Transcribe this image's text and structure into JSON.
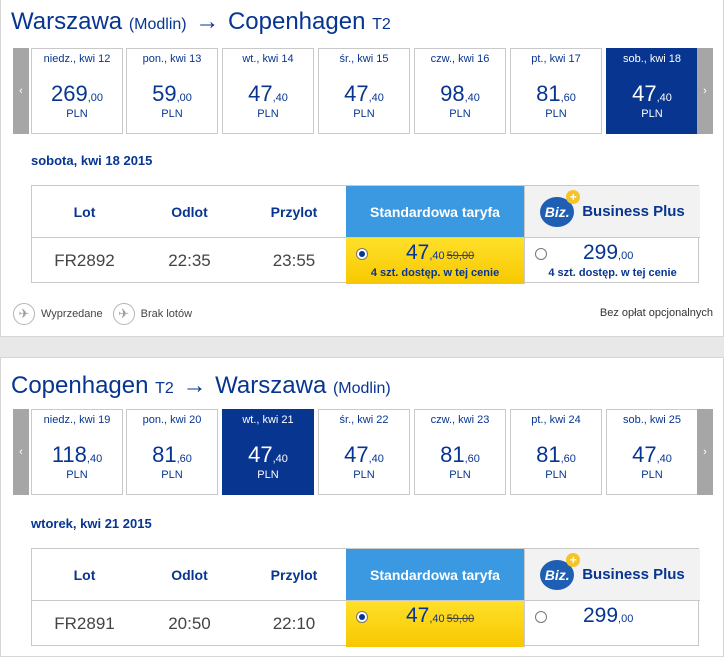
{
  "outbound": {
    "route": {
      "from": "Warszawa",
      "from_sub": "(Modlin)",
      "arrow": "→",
      "to": "Copenhagen",
      "to_sub": "T2"
    },
    "nav": {
      "prev": "‹",
      "next": "›"
    },
    "days": [
      {
        "label": "niedz., kwi 12",
        "int": "269",
        "dec": ",00",
        "cur": "PLN"
      },
      {
        "label": "pon., kwi 13",
        "int": "59",
        "dec": ",00",
        "cur": "PLN"
      },
      {
        "label": "wt., kwi 14",
        "int": "47",
        "dec": ",40",
        "cur": "PLN"
      },
      {
        "label": "śr., kwi 15",
        "int": "47",
        "dec": ",40",
        "cur": "PLN"
      },
      {
        "label": "czw., kwi 16",
        "int": "98",
        "dec": ",40",
        "cur": "PLN"
      },
      {
        "label": "pt., kwi 17",
        "int": "81",
        "dec": ",60",
        "cur": "PLN"
      },
      {
        "label": "sob., kwi 18",
        "int": "47",
        "dec": ",40",
        "cur": "PLN",
        "selected": true
      }
    ],
    "date": "sobota, kwi 18 2015",
    "headers": {
      "flight": "Lot",
      "dep": "Odlot",
      "arr": "Przylot",
      "standard": "Standardowa taryfa",
      "biz_logo": "Biz.",
      "biz_plus_mark": "+",
      "business": "Business Plus"
    },
    "row": {
      "flight": "FR2892",
      "dep": "22:35",
      "arr": "23:55",
      "std_int": "47",
      "std_dec": ",40",
      "std_old": "59,00",
      "std_avail": "4 szt. dostęp. w tej cenie",
      "biz_int": "299",
      "biz_dec": ",00",
      "biz_avail": "4 szt. dostęp. w tej cenie"
    },
    "legend": {
      "soldout": "Wyprzedane",
      "noflights": "Brak lotów",
      "soldout_icon": "plane-landing-icon",
      "noflights_icon": "no-flights-icon"
    },
    "optional_fees": "Bez opłat opcjonalnych"
  },
  "return": {
    "route": {
      "from": "Copenhagen",
      "from_sub": "T2",
      "arrow": "→",
      "to": "Warszawa",
      "to_sub": "(Modlin)"
    },
    "nav": {
      "prev": "‹",
      "next": "›"
    },
    "days": [
      {
        "label": "niedz., kwi 19",
        "int": "118",
        "dec": ",40",
        "cur": "PLN"
      },
      {
        "label": "pon., kwi 20",
        "int": "81",
        "dec": ",60",
        "cur": "PLN"
      },
      {
        "label": "wt., kwi 21",
        "int": "47",
        "dec": ",40",
        "cur": "PLN",
        "selected": true
      },
      {
        "label": "śr., kwi 22",
        "int": "47",
        "dec": ",40",
        "cur": "PLN"
      },
      {
        "label": "czw., kwi 23",
        "int": "81",
        "dec": ",60",
        "cur": "PLN"
      },
      {
        "label": "pt., kwi 24",
        "int": "81",
        "dec": ",60",
        "cur": "PLN"
      },
      {
        "label": "sob., kwi 25",
        "int": "47",
        "dec": ",40",
        "cur": "PLN"
      }
    ],
    "date": "wtorek, kwi 21 2015",
    "headers": {
      "flight": "Lot",
      "dep": "Odlot",
      "arr": "Przylot",
      "standard": "Standardowa taryfa",
      "biz_logo": "Biz.",
      "biz_plus_mark": "+",
      "business": "Business Plus"
    },
    "row": {
      "flight": "FR2891",
      "dep": "20:50",
      "arr": "22:10",
      "std_int": "47",
      "std_dec": ",40",
      "std_old": "59,00",
      "biz_int": "299",
      "biz_dec": ",00"
    }
  },
  "colors": {
    "brand": "#073590",
    "standard_header": "#3a99e0",
    "fare_yellow": "#f7c800",
    "nav_gray": "#a6a6a6"
  }
}
